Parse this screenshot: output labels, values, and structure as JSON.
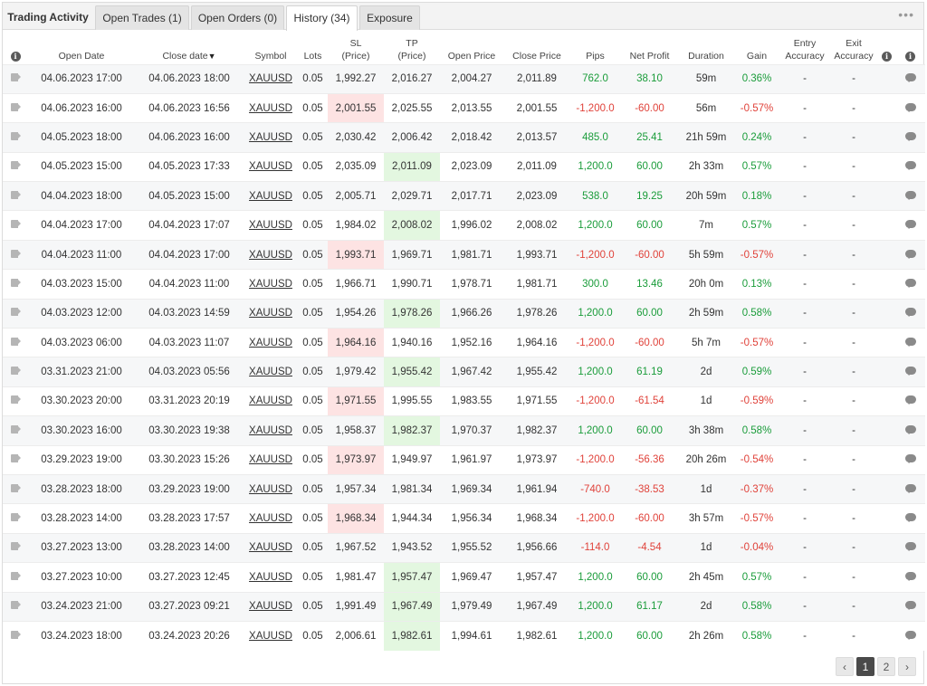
{
  "tabs": {
    "title": "Trading Activity",
    "open_trades": "Open Trades (1)",
    "open_orders": "Open Orders (0)",
    "history": "History (34)",
    "exposure": "Exposure"
  },
  "menu_dots": "•••",
  "columns": {
    "open_date": "Open Date",
    "close_date": "Close date",
    "sort_arrow": "▼",
    "symbol": "Symbol",
    "lots": "Lots",
    "sl_line1": "SL",
    "sl_line2": "(Price)",
    "tp_line1": "TP",
    "tp_line2": "(Price)",
    "open_price": "Open Price",
    "close_price": "Close Price",
    "pips": "Pips",
    "net_profit": "Net Profit",
    "duration": "Duration",
    "gain": "Gain",
    "entry_line1": "Entry",
    "entry_line2": "Accuracy",
    "exit_line1": "Exit",
    "exit_line2": "Accuracy",
    "info_glyph": "i"
  },
  "colors": {
    "positive": "#1a9c3a",
    "negative": "#e0423a",
    "sl_hit_bg": "#fde3e3",
    "tp_hit_bg": "#e3f7e0"
  },
  "rows": [
    {
      "open": "04.06.2023 17:00",
      "close": "04.06.2023 18:00",
      "symbol": "XAUUSD",
      "lots": "0.05",
      "sl": "1,992.27",
      "tp": "2,016.27",
      "open_price": "2,004.27",
      "close_price": "2,011.89",
      "pips": "762.0",
      "profit": "38.10",
      "duration": "59m",
      "gain": "0.36%",
      "entry": "-",
      "exit": "-",
      "hit": "",
      "sign": "pos"
    },
    {
      "open": "04.06.2023 16:00",
      "close": "04.06.2023 16:56",
      "symbol": "XAUUSD",
      "lots": "0.05",
      "sl": "2,001.55",
      "tp": "2,025.55",
      "open_price": "2,013.55",
      "close_price": "2,001.55",
      "pips": "-1,200.0",
      "profit": "-60.00",
      "duration": "56m",
      "gain": "-0.57%",
      "entry": "-",
      "exit": "-",
      "hit": "sl",
      "sign": "neg"
    },
    {
      "open": "04.05.2023 18:00",
      "close": "04.06.2023 16:00",
      "symbol": "XAUUSD",
      "lots": "0.05",
      "sl": "2,030.42",
      "tp": "2,006.42",
      "open_price": "2,018.42",
      "close_price": "2,013.57",
      "pips": "485.0",
      "profit": "25.41",
      "duration": "21h 59m",
      "gain": "0.24%",
      "entry": "-",
      "exit": "-",
      "hit": "",
      "sign": "pos"
    },
    {
      "open": "04.05.2023 15:00",
      "close": "04.05.2023 17:33",
      "symbol": "XAUUSD",
      "lots": "0.05",
      "sl": "2,035.09",
      "tp": "2,011.09",
      "open_price": "2,023.09",
      "close_price": "2,011.09",
      "pips": "1,200.0",
      "profit": "60.00",
      "duration": "2h 33m",
      "gain": "0.57%",
      "entry": "-",
      "exit": "-",
      "hit": "tp",
      "sign": "pos"
    },
    {
      "open": "04.04.2023 18:00",
      "close": "04.05.2023 15:00",
      "symbol": "XAUUSD",
      "lots": "0.05",
      "sl": "2,005.71",
      "tp": "2,029.71",
      "open_price": "2,017.71",
      "close_price": "2,023.09",
      "pips": "538.0",
      "profit": "19.25",
      "duration": "20h 59m",
      "gain": "0.18%",
      "entry": "-",
      "exit": "-",
      "hit": "",
      "sign": "pos"
    },
    {
      "open": "04.04.2023 17:00",
      "close": "04.04.2023 17:07",
      "symbol": "XAUUSD",
      "lots": "0.05",
      "sl": "1,984.02",
      "tp": "2,008.02",
      "open_price": "1,996.02",
      "close_price": "2,008.02",
      "pips": "1,200.0",
      "profit": "60.00",
      "duration": "7m",
      "gain": "0.57%",
      "entry": "-",
      "exit": "-",
      "hit": "tp",
      "sign": "pos"
    },
    {
      "open": "04.04.2023 11:00",
      "close": "04.04.2023 17:00",
      "symbol": "XAUUSD",
      "lots": "0.05",
      "sl": "1,993.71",
      "tp": "1,969.71",
      "open_price": "1,981.71",
      "close_price": "1,993.71",
      "pips": "-1,200.0",
      "profit": "-60.00",
      "duration": "5h 59m",
      "gain": "-0.57%",
      "entry": "-",
      "exit": "-",
      "hit": "sl",
      "sign": "neg"
    },
    {
      "open": "04.03.2023 15:00",
      "close": "04.04.2023 11:00",
      "symbol": "XAUUSD",
      "lots": "0.05",
      "sl": "1,966.71",
      "tp": "1,990.71",
      "open_price": "1,978.71",
      "close_price": "1,981.71",
      "pips": "300.0",
      "profit": "13.46",
      "duration": "20h 0m",
      "gain": "0.13%",
      "entry": "-",
      "exit": "-",
      "hit": "",
      "sign": "pos"
    },
    {
      "open": "04.03.2023 12:00",
      "close": "04.03.2023 14:59",
      "symbol": "XAUUSD",
      "lots": "0.05",
      "sl": "1,954.26",
      "tp": "1,978.26",
      "open_price": "1,966.26",
      "close_price": "1,978.26",
      "pips": "1,200.0",
      "profit": "60.00",
      "duration": "2h 59m",
      "gain": "0.58%",
      "entry": "-",
      "exit": "-",
      "hit": "tp",
      "sign": "pos"
    },
    {
      "open": "04.03.2023 06:00",
      "close": "04.03.2023 11:07",
      "symbol": "XAUUSD",
      "lots": "0.05",
      "sl": "1,964.16",
      "tp": "1,940.16",
      "open_price": "1,952.16",
      "close_price": "1,964.16",
      "pips": "-1,200.0",
      "profit": "-60.00",
      "duration": "5h 7m",
      "gain": "-0.57%",
      "entry": "-",
      "exit": "-",
      "hit": "sl",
      "sign": "neg"
    },
    {
      "open": "03.31.2023 21:00",
      "close": "04.03.2023 05:56",
      "symbol": "XAUUSD",
      "lots": "0.05",
      "sl": "1,979.42",
      "tp": "1,955.42",
      "open_price": "1,967.42",
      "close_price": "1,955.42",
      "pips": "1,200.0",
      "profit": "61.19",
      "duration": "2d",
      "gain": "0.59%",
      "entry": "-",
      "exit": "-",
      "hit": "tp",
      "sign": "pos"
    },
    {
      "open": "03.30.2023 20:00",
      "close": "03.31.2023 20:19",
      "symbol": "XAUUSD",
      "lots": "0.05",
      "sl": "1,971.55",
      "tp": "1,995.55",
      "open_price": "1,983.55",
      "close_price": "1,971.55",
      "pips": "-1,200.0",
      "profit": "-61.54",
      "duration": "1d",
      "gain": "-0.59%",
      "entry": "-",
      "exit": "-",
      "hit": "sl",
      "sign": "neg"
    },
    {
      "open": "03.30.2023 16:00",
      "close": "03.30.2023 19:38",
      "symbol": "XAUUSD",
      "lots": "0.05",
      "sl": "1,958.37",
      "tp": "1,982.37",
      "open_price": "1,970.37",
      "close_price": "1,982.37",
      "pips": "1,200.0",
      "profit": "60.00",
      "duration": "3h 38m",
      "gain": "0.58%",
      "entry": "-",
      "exit": "-",
      "hit": "tp",
      "sign": "pos"
    },
    {
      "open": "03.29.2023 19:00",
      "close": "03.30.2023 15:26",
      "symbol": "XAUUSD",
      "lots": "0.05",
      "sl": "1,973.97",
      "tp": "1,949.97",
      "open_price": "1,961.97",
      "close_price": "1,973.97",
      "pips": "-1,200.0",
      "profit": "-56.36",
      "duration": "20h 26m",
      "gain": "-0.54%",
      "entry": "-",
      "exit": "-",
      "hit": "sl",
      "sign": "neg"
    },
    {
      "open": "03.28.2023 18:00",
      "close": "03.29.2023 19:00",
      "symbol": "XAUUSD",
      "lots": "0.05",
      "sl": "1,957.34",
      "tp": "1,981.34",
      "open_price": "1,969.34",
      "close_price": "1,961.94",
      "pips": "-740.0",
      "profit": "-38.53",
      "duration": "1d",
      "gain": "-0.37%",
      "entry": "-",
      "exit": "-",
      "hit": "",
      "sign": "neg"
    },
    {
      "open": "03.28.2023 14:00",
      "close": "03.28.2023 17:57",
      "symbol": "XAUUSD",
      "lots": "0.05",
      "sl": "1,968.34",
      "tp": "1,944.34",
      "open_price": "1,956.34",
      "close_price": "1,968.34",
      "pips": "-1,200.0",
      "profit": "-60.00",
      "duration": "3h 57m",
      "gain": "-0.57%",
      "entry": "-",
      "exit": "-",
      "hit": "sl",
      "sign": "neg"
    },
    {
      "open": "03.27.2023 13:00",
      "close": "03.28.2023 14:00",
      "symbol": "XAUUSD",
      "lots": "0.05",
      "sl": "1,967.52",
      "tp": "1,943.52",
      "open_price": "1,955.52",
      "close_price": "1,956.66",
      "pips": "-114.0",
      "profit": "-4.54",
      "duration": "1d",
      "gain": "-0.04%",
      "entry": "-",
      "exit": "-",
      "hit": "",
      "sign": "neg"
    },
    {
      "open": "03.27.2023 10:00",
      "close": "03.27.2023 12:45",
      "symbol": "XAUUSD",
      "lots": "0.05",
      "sl": "1,981.47",
      "tp": "1,957.47",
      "open_price": "1,969.47",
      "close_price": "1,957.47",
      "pips": "1,200.0",
      "profit": "60.00",
      "duration": "2h 45m",
      "gain": "0.57%",
      "entry": "-",
      "exit": "-",
      "hit": "tp",
      "sign": "pos"
    },
    {
      "open": "03.24.2023 21:00",
      "close": "03.27.2023 09:21",
      "symbol": "XAUUSD",
      "lots": "0.05",
      "sl": "1,991.49",
      "tp": "1,967.49",
      "open_price": "1,979.49",
      "close_price": "1,967.49",
      "pips": "1,200.0",
      "profit": "61.17",
      "duration": "2d",
      "gain": "0.58%",
      "entry": "-",
      "exit": "-",
      "hit": "tp",
      "sign": "pos"
    },
    {
      "open": "03.24.2023 18:00",
      "close": "03.24.2023 20:26",
      "symbol": "XAUUSD",
      "lots": "0.05",
      "sl": "2,006.61",
      "tp": "1,982.61",
      "open_price": "1,994.61",
      "close_price": "1,982.61",
      "pips": "1,200.0",
      "profit": "60.00",
      "duration": "2h 26m",
      "gain": "0.58%",
      "entry": "-",
      "exit": "-",
      "hit": "tp",
      "sign": "pos"
    }
  ],
  "pagination": {
    "prev": "‹",
    "pages": [
      "1",
      "2"
    ],
    "current": "1",
    "next": "›"
  }
}
